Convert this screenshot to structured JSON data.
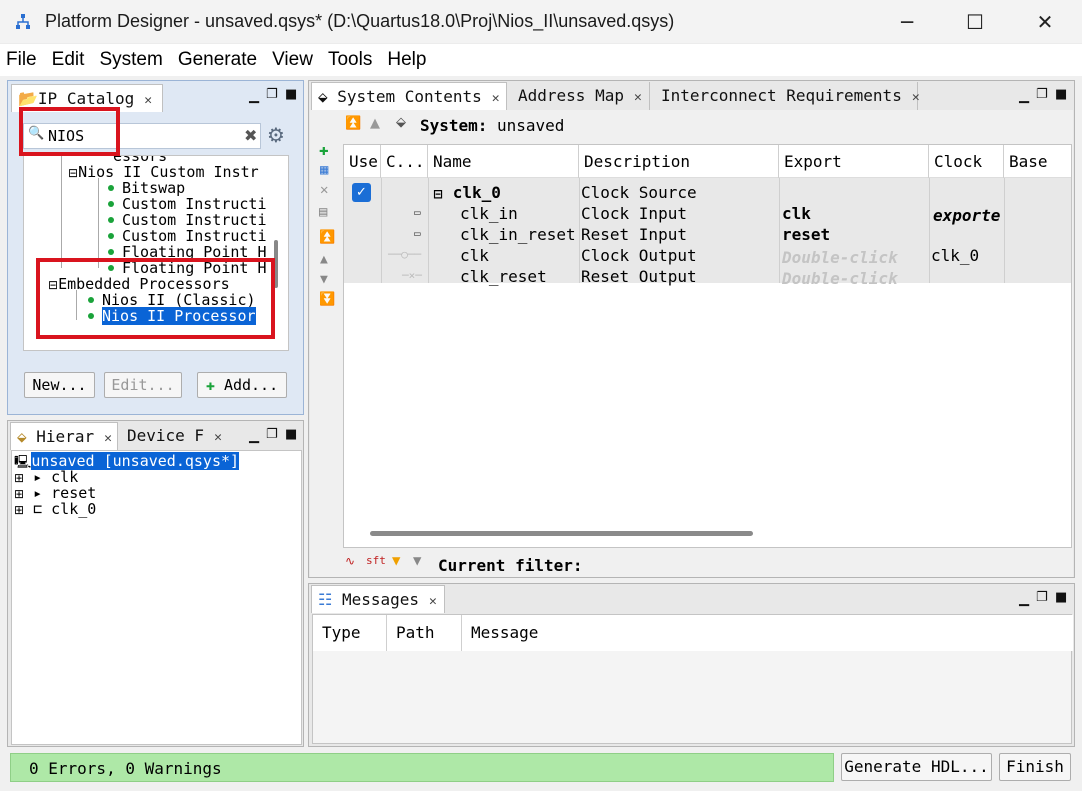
{
  "window": {
    "title": "Platform Designer - unsaved.qsys* (D:\\Quartus18.0\\Proj\\Nios_II\\unsaved.qsys)",
    "minimize": "─",
    "maximize": "☐",
    "close": "✕"
  },
  "menu": [
    "File",
    "Edit",
    "System",
    "Generate",
    "View",
    "Tools",
    "Help"
  ],
  "ip_catalog": {
    "tab_label": "IP Catalog",
    "search_value": "NIOS",
    "tree": {
      "partial_top": "essors",
      "custom_group": "Nios II Custom Instr",
      "custom_items": [
        "Bitswap",
        "Custom Instructi",
        "Custom Instructi",
        "Custom Instructi",
        "Floating Point H",
        "Floating Point H"
      ],
      "embedded_group": "Embedded Processors",
      "embedded_items": [
        "Nios II (Classic)",
        "Nios II Processor"
      ]
    },
    "buttons": {
      "new": "New...",
      "edit": "Edit...",
      "add": "Add..."
    }
  },
  "hierarchy": {
    "tabs": [
      "Hierar",
      "Device F"
    ],
    "root": "unsaved [unsaved.qsys*]",
    "items": [
      "clk",
      "reset",
      "clk_0"
    ]
  },
  "system_contents": {
    "tabs": [
      "System Contents",
      "Address Map",
      "Interconnect Requirements"
    ],
    "system_label": "System:",
    "system_name": "unsaved",
    "columns": [
      "Use",
      "C...",
      "Name",
      "Description",
      "Export",
      "Clock",
      "Base"
    ],
    "rows": [
      {
        "name": "clk_0",
        "description": "Clock Source",
        "export": "",
        "clock": "",
        "bold": true
      },
      {
        "name": "clk_in",
        "description": "Clock Input",
        "export": "clk",
        "clock": "exporte"
      },
      {
        "name": "clk_in_reset",
        "description": "Reset Input",
        "export": "reset",
        "clock": ""
      },
      {
        "name": "clk",
        "description": "Clock Output",
        "export": "Double-click",
        "clock": "clk_0"
      },
      {
        "name": "clk_reset",
        "description": "Reset Output",
        "export": "Double-click",
        "clock": ""
      }
    ],
    "filter_label": "Current filter:"
  },
  "messages": {
    "tab_label": "Messages",
    "columns": [
      "Type",
      "Path",
      "Message"
    ]
  },
  "status": {
    "text": "0 Errors, 0 Warnings",
    "generate_button": "Generate HDL...",
    "finish_button": "Finish"
  },
  "colors": {
    "status_bg": "#aee8a7",
    "selection": "#0a64d6",
    "highlight_box": "#d9141e"
  }
}
